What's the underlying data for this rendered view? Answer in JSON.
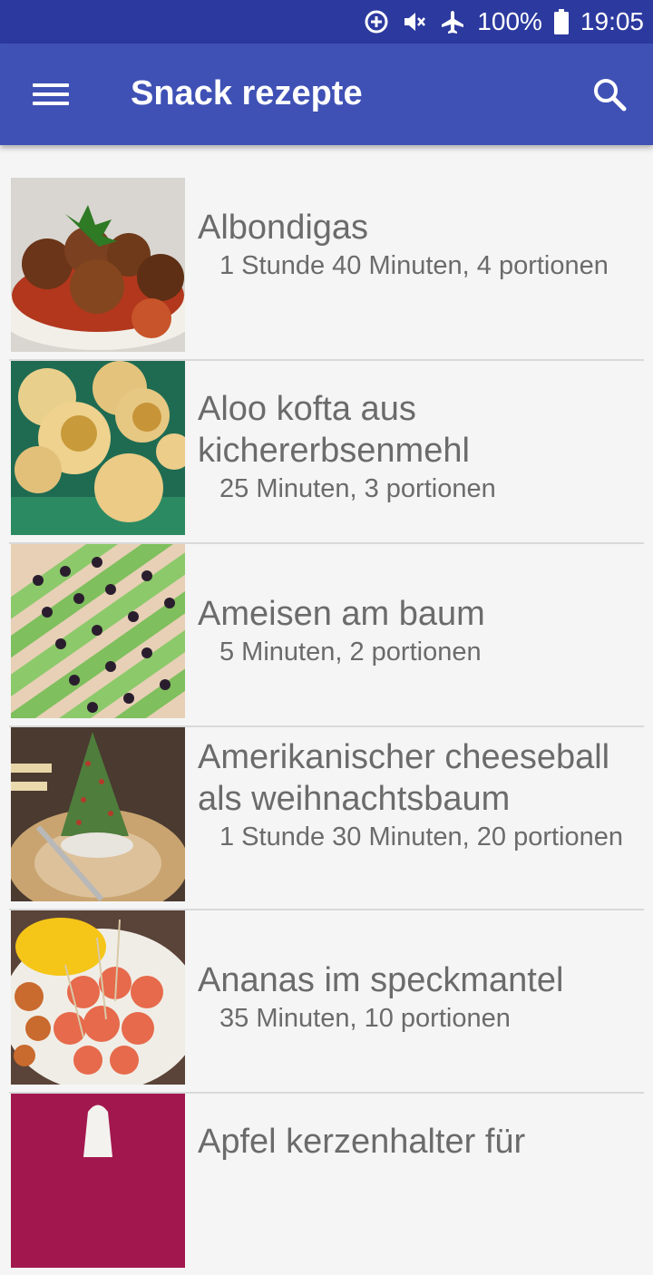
{
  "status_bar": {
    "battery": "100%",
    "time": "19:05",
    "icons": [
      "data-saver-icon",
      "mute-icon",
      "airplane-icon",
      "battery-icon"
    ]
  },
  "app_bar": {
    "title": "Snack rezepte",
    "menu_icon": "hamburger-menu-icon",
    "search_icon": "search-icon",
    "color": "#3f51b5",
    "status_color": "#2c3a9f"
  },
  "recipes": [
    {
      "title": "Albondigas",
      "meta": "1 Stunde 40 Minuten, 4 portionen"
    },
    {
      "title": "Aloo kofta aus kichererbsenmehl",
      "meta": "25 Minuten, 3 portionen"
    },
    {
      "title": "Ameisen am baum",
      "meta": "5 Minuten, 2 portionen"
    },
    {
      "title": "Amerikanischer cheeseball als weihnachtsbaum",
      "meta": "1 Stunde 30 Minuten, 20 portionen"
    },
    {
      "title": "Ananas im speckmantel",
      "meta": "35 Minuten, 10 portionen"
    },
    {
      "title": "Apfel kerzenhalter für",
      "meta": ""
    }
  ]
}
